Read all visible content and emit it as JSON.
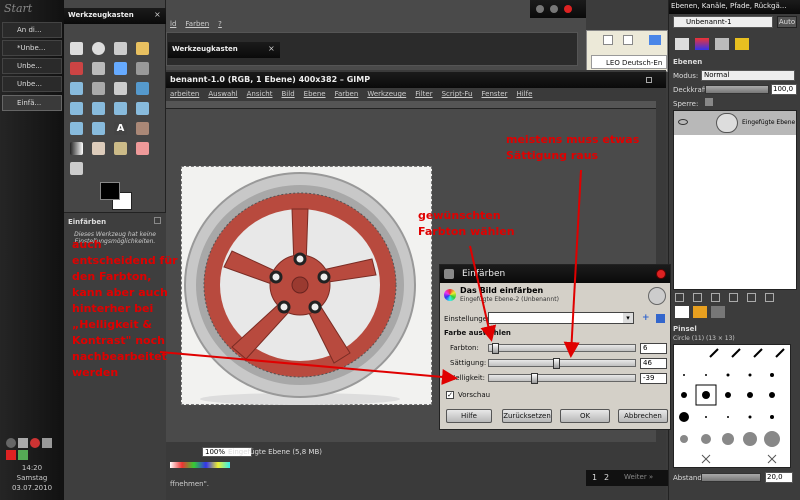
{
  "taskbar": {
    "start_label": "Start",
    "items": [
      "An di...",
      "*Unbe...",
      "Unbe...",
      "Unbe...",
      "Einfä..."
    ],
    "clock": {
      "time": "14:20",
      "day": "Samstag",
      "date": "03.07.2010"
    }
  },
  "toolbox": {
    "title": "Werkzeugkasten",
    "title2": "Werkzeugkasten",
    "tool_options_title": "Einfärben",
    "tool_options_note": "Dieses Werkzeug hat keine Einstellungsmöglichkeiten."
  },
  "bg_window": {
    "menu": [
      "ld",
      "Farben",
      "?"
    ],
    "title_frag": "Unbenannt-1"
  },
  "gimp": {
    "title": "benannt-1.0 (RGB, 1 Ebene) 400x382 – GIMP",
    "menu": [
      "arbeiten",
      "Auswahl",
      "Ansicht",
      "Bild",
      "Ebene",
      "Farben",
      "Werkzeuge",
      "Filter",
      "Script-Fu",
      "Fenster",
      "Hilfe"
    ],
    "zoom": "100%",
    "status": "Eingefügte Ebene (5,8 MB)",
    "bottom_msg": "ffnehmen\"."
  },
  "browser_tabs": {
    "tab": "LEO Deutsch-En"
  },
  "dialog": {
    "title": "Einfärben",
    "heading": "Das Bild einfärben",
    "subheading": "Eingefügte Ebene-2 (Unbenannt)",
    "settings_label": "Einstellungen:",
    "group_label": "Farbe auswählen",
    "sliders": [
      {
        "label": "Farbton:",
        "value": "6",
        "fraction": 0.02
      },
      {
        "label": "Sättigung:",
        "value": "46",
        "fraction": 0.46
      },
      {
        "label": "Helligkeit:",
        "value": "-39",
        "fraction": 0.3
      }
    ],
    "preview_label": "Vorschau",
    "buttons": {
      "help": "Hilfe",
      "reset": "Zurücksetzen",
      "ok": "OK",
      "cancel": "Abbrechen"
    }
  },
  "layers": {
    "title": "Ebenen, Kanäle, Pfade, Rückgä...",
    "image_select": "Unbenannt-1",
    "auto": "Auto",
    "section": "Ebenen",
    "mode_label": "Modus:",
    "mode_value": "Normal",
    "opacity_label": "Deckkraft:",
    "opacity_value": "100,0",
    "lock_label": "Sperre:",
    "layer_name": "Eingefügte Ebene"
  },
  "brushes": {
    "title": "Pinsel",
    "brush_name": "Circle (11) (13 × 13)",
    "spacing_label": "Abstand:",
    "spacing_value": "20,0"
  },
  "bottom_nav": {
    "pages": [
      "1",
      "2"
    ],
    "next": "Weiter »"
  },
  "annotations": {
    "left": "auch\nentscheidend für\nden Farbton,\nkann aber auch\nhinterher bei\n„Helligkeit &\nKontrast\" noch\nnachbearbeitet\nwerden",
    "mid": "gewünschten\nFarbton wählen",
    "top": "meistens muss etwas\nSättigung raus"
  },
  "colors": {
    "accent_red": "#e00000",
    "rim_red": "#b84a3e",
    "dialog_bg": "#d4d0c8"
  }
}
